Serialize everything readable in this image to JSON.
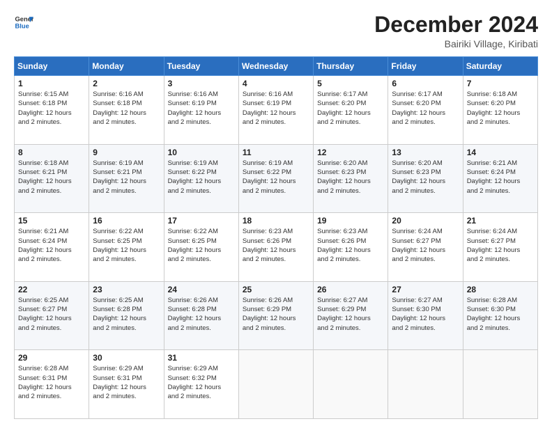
{
  "logo": {
    "line1": "General",
    "line2": "Blue"
  },
  "header": {
    "title": "December 2024",
    "subtitle": "Bairiki Village, Kiribati"
  },
  "weekdays": [
    "Sunday",
    "Monday",
    "Tuesday",
    "Wednesday",
    "Thursday",
    "Friday",
    "Saturday"
  ],
  "weeks": [
    [
      {
        "day": "1",
        "sunrise": "6:15 AM",
        "sunset": "6:18 PM",
        "daylight": "12 hours and 2 minutes."
      },
      {
        "day": "2",
        "sunrise": "6:16 AM",
        "sunset": "6:18 PM",
        "daylight": "12 hours and 2 minutes."
      },
      {
        "day": "3",
        "sunrise": "6:16 AM",
        "sunset": "6:19 PM",
        "daylight": "12 hours and 2 minutes."
      },
      {
        "day": "4",
        "sunrise": "6:16 AM",
        "sunset": "6:19 PM",
        "daylight": "12 hours and 2 minutes."
      },
      {
        "day": "5",
        "sunrise": "6:17 AM",
        "sunset": "6:20 PM",
        "daylight": "12 hours and 2 minutes."
      },
      {
        "day": "6",
        "sunrise": "6:17 AM",
        "sunset": "6:20 PM",
        "daylight": "12 hours and 2 minutes."
      },
      {
        "day": "7",
        "sunrise": "6:18 AM",
        "sunset": "6:20 PM",
        "daylight": "12 hours and 2 minutes."
      }
    ],
    [
      {
        "day": "8",
        "sunrise": "6:18 AM",
        "sunset": "6:21 PM",
        "daylight": "12 hours and 2 minutes."
      },
      {
        "day": "9",
        "sunrise": "6:19 AM",
        "sunset": "6:21 PM",
        "daylight": "12 hours and 2 minutes."
      },
      {
        "day": "10",
        "sunrise": "6:19 AM",
        "sunset": "6:22 PM",
        "daylight": "12 hours and 2 minutes."
      },
      {
        "day": "11",
        "sunrise": "6:19 AM",
        "sunset": "6:22 PM",
        "daylight": "12 hours and 2 minutes."
      },
      {
        "day": "12",
        "sunrise": "6:20 AM",
        "sunset": "6:23 PM",
        "daylight": "12 hours and 2 minutes."
      },
      {
        "day": "13",
        "sunrise": "6:20 AM",
        "sunset": "6:23 PM",
        "daylight": "12 hours and 2 minutes."
      },
      {
        "day": "14",
        "sunrise": "6:21 AM",
        "sunset": "6:24 PM",
        "daylight": "12 hours and 2 minutes."
      }
    ],
    [
      {
        "day": "15",
        "sunrise": "6:21 AM",
        "sunset": "6:24 PM",
        "daylight": "12 hours and 2 minutes."
      },
      {
        "day": "16",
        "sunrise": "6:22 AM",
        "sunset": "6:25 PM",
        "daylight": "12 hours and 2 minutes."
      },
      {
        "day": "17",
        "sunrise": "6:22 AM",
        "sunset": "6:25 PM",
        "daylight": "12 hours and 2 minutes."
      },
      {
        "day": "18",
        "sunrise": "6:23 AM",
        "sunset": "6:26 PM",
        "daylight": "12 hours and 2 minutes."
      },
      {
        "day": "19",
        "sunrise": "6:23 AM",
        "sunset": "6:26 PM",
        "daylight": "12 hours and 2 minutes."
      },
      {
        "day": "20",
        "sunrise": "6:24 AM",
        "sunset": "6:27 PM",
        "daylight": "12 hours and 2 minutes."
      },
      {
        "day": "21",
        "sunrise": "6:24 AM",
        "sunset": "6:27 PM",
        "daylight": "12 hours and 2 minutes."
      }
    ],
    [
      {
        "day": "22",
        "sunrise": "6:25 AM",
        "sunset": "6:27 PM",
        "daylight": "12 hours and 2 minutes."
      },
      {
        "day": "23",
        "sunrise": "6:25 AM",
        "sunset": "6:28 PM",
        "daylight": "12 hours and 2 minutes."
      },
      {
        "day": "24",
        "sunrise": "6:26 AM",
        "sunset": "6:28 PM",
        "daylight": "12 hours and 2 minutes."
      },
      {
        "day": "25",
        "sunrise": "6:26 AM",
        "sunset": "6:29 PM",
        "daylight": "12 hours and 2 minutes."
      },
      {
        "day": "26",
        "sunrise": "6:27 AM",
        "sunset": "6:29 PM",
        "daylight": "12 hours and 2 minutes."
      },
      {
        "day": "27",
        "sunrise": "6:27 AM",
        "sunset": "6:30 PM",
        "daylight": "12 hours and 2 minutes."
      },
      {
        "day": "28",
        "sunrise": "6:28 AM",
        "sunset": "6:30 PM",
        "daylight": "12 hours and 2 minutes."
      }
    ],
    [
      {
        "day": "29",
        "sunrise": "6:28 AM",
        "sunset": "6:31 PM",
        "daylight": "12 hours and 2 minutes."
      },
      {
        "day": "30",
        "sunrise": "6:29 AM",
        "sunset": "6:31 PM",
        "daylight": "12 hours and 2 minutes."
      },
      {
        "day": "31",
        "sunrise": "6:29 AM",
        "sunset": "6:32 PM",
        "daylight": "12 hours and 2 minutes."
      },
      null,
      null,
      null,
      null
    ]
  ],
  "labels": {
    "sunrise": "Sunrise:",
    "sunset": "Sunset:",
    "daylight": "Daylight:"
  }
}
